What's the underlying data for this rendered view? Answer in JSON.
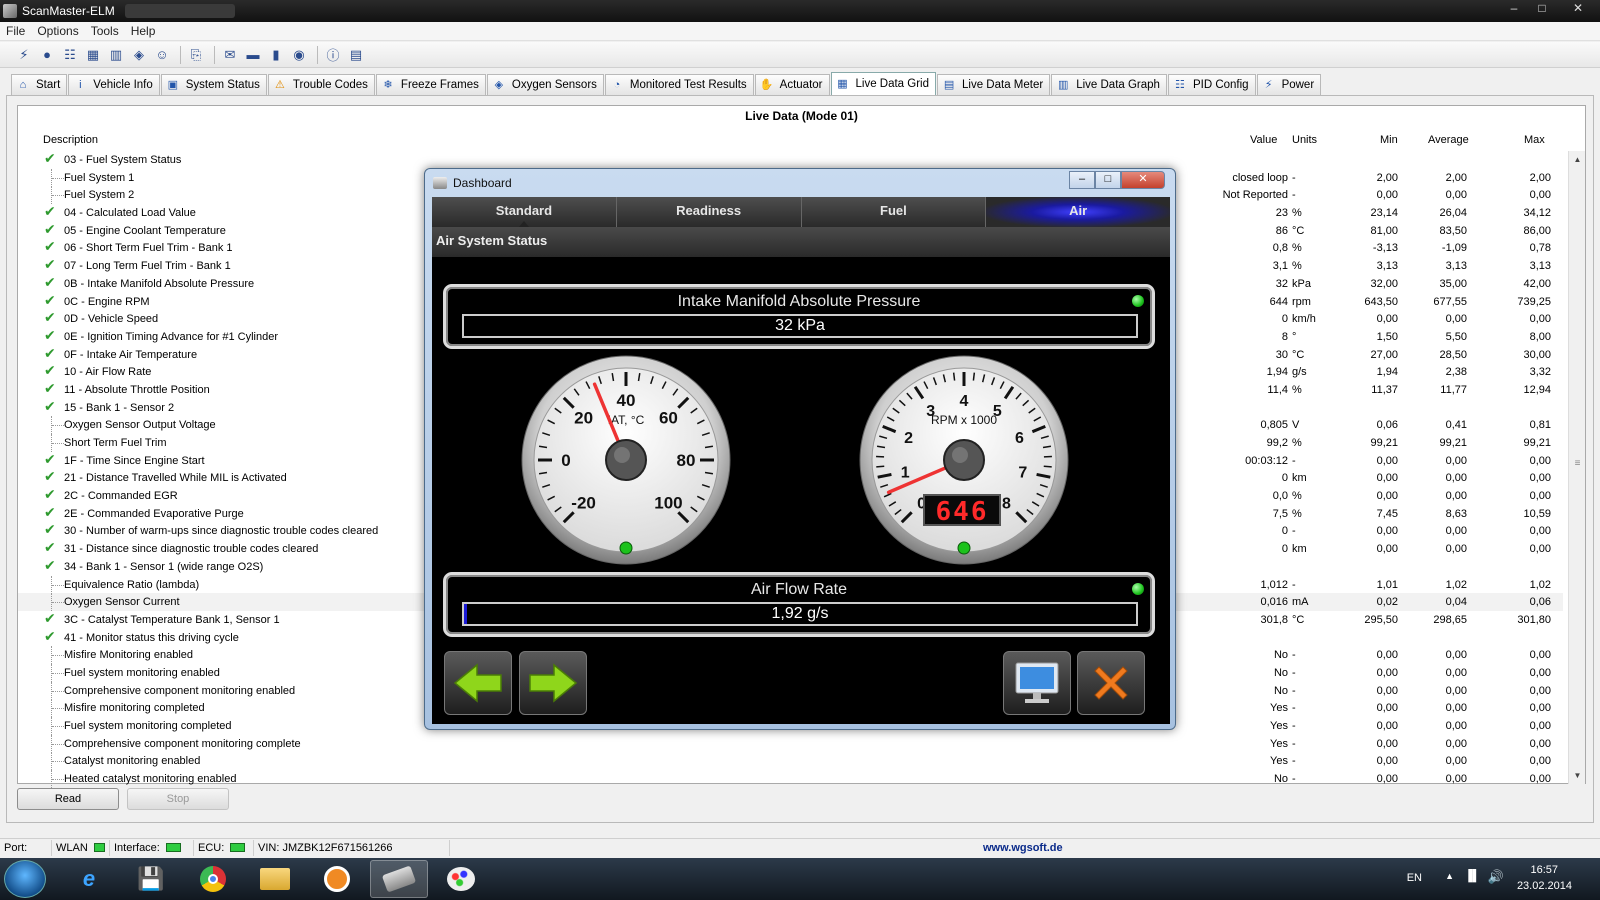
{
  "window": {
    "title": "ScanMaster-ELM"
  },
  "menu": [
    "File",
    "Options",
    "Tools",
    "Help"
  ],
  "toolbar_icons": [
    "connect-icon",
    "globe-icon",
    "report-icon",
    "grid-icon",
    "chart-icon",
    "palette-icon",
    "person-icon",
    "clipboard-icon",
    "chat-icon",
    "terminal-icon",
    "battery-icon",
    "disc-icon",
    "info-icon",
    "book-icon"
  ],
  "tabs": [
    {
      "label": "Start",
      "icon": "home-icon"
    },
    {
      "label": "Vehicle Info",
      "icon": "info-icon"
    },
    {
      "label": "System Status",
      "icon": "status-icon"
    },
    {
      "label": "Trouble Codes",
      "icon": "warning-icon"
    },
    {
      "label": "Freeze Frames",
      "icon": "freeze-icon"
    },
    {
      "label": "Oxygen Sensors",
      "icon": "sensor-icon"
    },
    {
      "label": "Monitored Test Results",
      "icon": "gauge-icon"
    },
    {
      "label": "Actuator",
      "icon": "actuator-icon"
    },
    {
      "label": "Live Data Grid",
      "icon": "grid-icon"
    },
    {
      "label": "Live Data Meter",
      "icon": "meter-icon"
    },
    {
      "label": "Live Data Graph",
      "icon": "graph-icon"
    },
    {
      "label": "PID Config",
      "icon": "config-icon"
    },
    {
      "label": "Power",
      "icon": "power-icon"
    }
  ],
  "active_tab": "Live Data Grid",
  "grid": {
    "title": "Live Data (Mode 01)",
    "headers": {
      "description": "Description",
      "value": "Value",
      "units": "Units",
      "min": "Min",
      "average": "Average",
      "max": "Max"
    },
    "rows": [
      {
        "c": true,
        "d": "03 - Fuel System Status",
        "v": "",
        "u": "",
        "mn": "",
        "av": "",
        "mx": ""
      },
      {
        "c": false,
        "d": "Fuel System 1",
        "v": "closed loop",
        "u": "-",
        "mn": "2,00",
        "av": "2,00",
        "mx": "2,00"
      },
      {
        "c": false,
        "d": "Fuel System 2",
        "v": "Not Reported",
        "u": "-",
        "mn": "0,00",
        "av": "0,00",
        "mx": "0,00"
      },
      {
        "c": true,
        "d": "04 - Calculated Load Value",
        "v": "23",
        "u": "%",
        "mn": "23,14",
        "av": "26,04",
        "mx": "34,12"
      },
      {
        "c": true,
        "d": "05 - Engine Coolant Temperature",
        "v": "86",
        "u": "°C",
        "mn": "81,00",
        "av": "83,50",
        "mx": "86,00"
      },
      {
        "c": true,
        "d": "06 - Short Term Fuel Trim - Bank 1",
        "v": "0,8",
        "u": "%",
        "mn": "-3,13",
        "av": "-1,09",
        "mx": "0,78"
      },
      {
        "c": true,
        "d": "07 - Long Term Fuel Trim - Bank 1",
        "v": "3,1",
        "u": "%",
        "mn": "3,13",
        "av": "3,13",
        "mx": "3,13"
      },
      {
        "c": true,
        "d": "0B - Intake Manifold Absolute Pressure",
        "v": "32",
        "u": "kPa",
        "mn": "32,00",
        "av": "35,00",
        "mx": "42,00"
      },
      {
        "c": true,
        "d": "0C - Engine RPM",
        "v": "644",
        "u": "rpm",
        "mn": "643,50",
        "av": "677,55",
        "mx": "739,25"
      },
      {
        "c": true,
        "d": "0D - Vehicle Speed",
        "v": "0",
        "u": "km/h",
        "mn": "0,00",
        "av": "0,00",
        "mx": "0,00"
      },
      {
        "c": true,
        "d": "0E - Ignition Timing Advance for #1 Cylinder",
        "v": "8",
        "u": "°",
        "mn": "1,50",
        "av": "5,50",
        "mx": "8,00"
      },
      {
        "c": true,
        "d": "0F - Intake Air Temperature",
        "v": "30",
        "u": "°C",
        "mn": "27,00",
        "av": "28,50",
        "mx": "30,00"
      },
      {
        "c": true,
        "d": "10 - Air Flow Rate",
        "v": "1,94",
        "u": "g/s",
        "mn": "1,94",
        "av": "2,38",
        "mx": "3,32"
      },
      {
        "c": true,
        "d": "11 - Absolute Throttle Position",
        "v": "11,4",
        "u": "%",
        "mn": "11,37",
        "av": "11,77",
        "mx": "12,94"
      },
      {
        "c": true,
        "d": "15 - Bank 1 - Sensor 2",
        "v": "",
        "u": "",
        "mn": "",
        "av": "",
        "mx": ""
      },
      {
        "c": false,
        "d": "Oxygen Sensor Output Voltage",
        "v": "0,805",
        "u": "V",
        "mn": "0,06",
        "av": "0,41",
        "mx": "0,81"
      },
      {
        "c": false,
        "d": "Short Term Fuel Trim",
        "v": "99,2",
        "u": "%",
        "mn": "99,21",
        "av": "99,21",
        "mx": "99,21"
      },
      {
        "c": true,
        "d": "1F - Time Since Engine Start",
        "v": "00:03:12",
        "u": "-",
        "mn": "0,00",
        "av": "0,00",
        "mx": "0,00"
      },
      {
        "c": true,
        "d": "21 - Distance Travelled While MIL is Activated",
        "v": "0",
        "u": "km",
        "mn": "0,00",
        "av": "0,00",
        "mx": "0,00"
      },
      {
        "c": true,
        "d": "2C - Commanded EGR",
        "v": "0,0",
        "u": "%",
        "mn": "0,00",
        "av": "0,00",
        "mx": "0,00"
      },
      {
        "c": true,
        "d": "2E - Commanded Evaporative Purge",
        "v": "7,5",
        "u": "%",
        "mn": "7,45",
        "av": "8,63",
        "mx": "10,59"
      },
      {
        "c": true,
        "d": "30 - Number of warm-ups since diagnostic trouble codes cleared",
        "v": "0",
        "u": "-",
        "mn": "0,00",
        "av": "0,00",
        "mx": "0,00"
      },
      {
        "c": true,
        "d": "31 - Distance since diagnostic trouble codes cleared",
        "v": "0",
        "u": "km",
        "mn": "0,00",
        "av": "0,00",
        "mx": "0,00"
      },
      {
        "c": true,
        "d": "34 - Bank 1 - Sensor 1 (wide range O2S)",
        "v": "",
        "u": "",
        "mn": "",
        "av": "",
        "mx": ""
      },
      {
        "c": false,
        "d": "Equivalence Ratio (lambda)",
        "v": "1,012",
        "u": "-",
        "mn": "1,01",
        "av": "1,02",
        "mx": "1,02"
      },
      {
        "c": false,
        "d": "Oxygen Sensor Current",
        "v": "0,016",
        "u": "mA",
        "mn": "0,02",
        "av": "0,04",
        "mx": "0,06"
      },
      {
        "c": true,
        "d": "3C - Catalyst Temperature Bank 1, Sensor 1",
        "v": "301,8",
        "u": "°C",
        "mn": "295,50",
        "av": "298,65",
        "mx": "301,80"
      },
      {
        "c": true,
        "d": "41 - Monitor status this driving cycle",
        "v": "",
        "u": "",
        "mn": "",
        "av": "",
        "mx": ""
      },
      {
        "c": false,
        "d": "Misfire Monitoring enabled",
        "v": "No",
        "u": "-",
        "mn": "0,00",
        "av": "0,00",
        "mx": "0,00"
      },
      {
        "c": false,
        "d": "Fuel system monitoring enabled",
        "v": "No",
        "u": "-",
        "mn": "0,00",
        "av": "0,00",
        "mx": "0,00"
      },
      {
        "c": false,
        "d": "Comprehensive component monitoring enabled",
        "v": "No",
        "u": "-",
        "mn": "0,00",
        "av": "0,00",
        "mx": "0,00"
      },
      {
        "c": false,
        "d": "Misfire monitoring completed",
        "v": "Yes",
        "u": "-",
        "mn": "0,00",
        "av": "0,00",
        "mx": "0,00"
      },
      {
        "c": false,
        "d": "Fuel system monitoring completed",
        "v": "Yes",
        "u": "-",
        "mn": "0,00",
        "av": "0,00",
        "mx": "0,00"
      },
      {
        "c": false,
        "d": "Comprehensive component monitoring complete",
        "v": "Yes",
        "u": "-",
        "mn": "0,00",
        "av": "0,00",
        "mx": "0,00"
      },
      {
        "c": false,
        "d": "Catalyst monitoring enabled",
        "v": "Yes",
        "u": "-",
        "mn": "0,00",
        "av": "0,00",
        "mx": "0,00"
      },
      {
        "c": false,
        "d": "Heated catalyst monitoring enabled",
        "v": "No",
        "u": "-",
        "mn": "0,00",
        "av": "0,00",
        "mx": "0,00"
      }
    ]
  },
  "buttons": {
    "read": "Read",
    "stop": "Stop"
  },
  "status": {
    "port_label": "Port:",
    "wlan_label": "WLAN",
    "interface_label": "Interface:",
    "ecu_label": "ECU:",
    "vin": "VIN: JMZBK12F671561266",
    "url": "www.wgsoft.de"
  },
  "dashboard": {
    "title": "Dashboard",
    "tabs": [
      "Standard",
      "Readiness",
      "Fuel",
      "Air"
    ],
    "active_tab": "Air",
    "subtitle": "Air System Status",
    "map_label": "Intake Manifold Absolute Pressure",
    "map_value": "32 kPa",
    "map_fill_fraction": 0,
    "maf_label": "Air Flow Rate",
    "maf_value": "1,92 g/s",
    "maf_fill_fraction": 0.005,
    "iat_gauge": {
      "label": "IAT, °C",
      "ticks": [
        "-20",
        "0",
        "20",
        "40",
        "60",
        "80",
        "100"
      ],
      "value": 30
    },
    "rpm_gauge": {
      "label": "RPM x 1000",
      "ticks": [
        "0",
        "1",
        "2",
        "3",
        "4",
        "5",
        "6",
        "7",
        "8"
      ],
      "value": 0.646,
      "digital": "646"
    }
  },
  "taskbar": {
    "apps": [
      "ie-icon",
      "save-icon",
      "chrome-icon",
      "folder-icon",
      "magnifier-icon",
      "scanner-icon",
      "paint-icon"
    ],
    "active_app": "scanner-icon",
    "lang": "EN",
    "time": "16:57",
    "date": "23.02.2014"
  },
  "colors": {
    "check": "#2f9a2f",
    "led_green": "#1cc21c",
    "map_fill": "#1b1bd6",
    "air_tab": "#3030ff",
    "needle": "#e33"
  }
}
